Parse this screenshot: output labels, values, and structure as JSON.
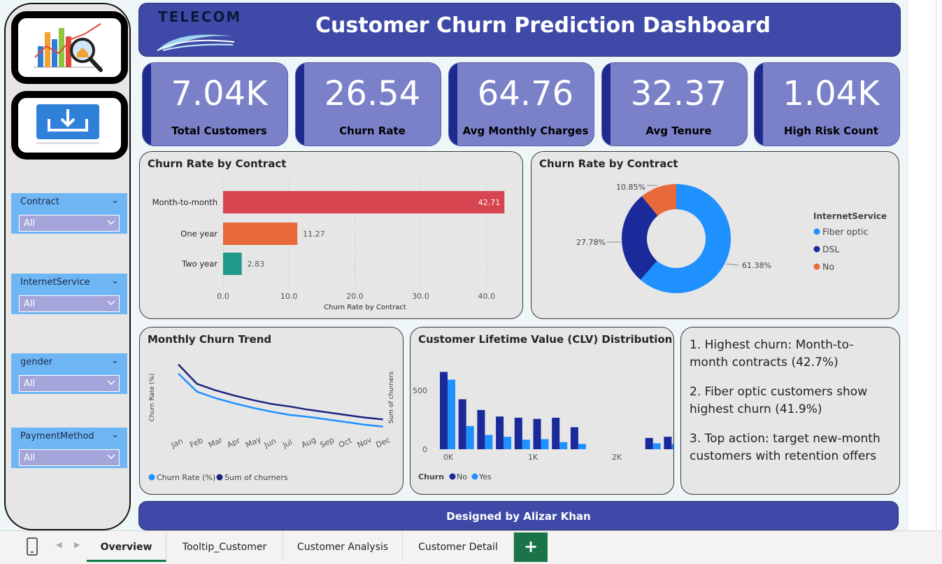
{
  "header": {
    "logo_text": "TELECOM",
    "title": "Customer Churn Prediction Dashboard"
  },
  "slicers": [
    {
      "label": "Contract",
      "value": "All"
    },
    {
      "label": "InternetService",
      "value": "All"
    },
    {
      "label": "gender",
      "value": "All"
    },
    {
      "label": "PaymentMethod",
      "value": "All"
    }
  ],
  "kpis": [
    {
      "value": "7.04K",
      "label": "Total Customers"
    },
    {
      "value": "26.54",
      "label": "Churn Rate"
    },
    {
      "value": "64.76",
      "label": "Avg Monthly Charges"
    },
    {
      "value": "32.37",
      "label": "Avg Tenure"
    },
    {
      "value": "1.04K",
      "label": "High Risk Count"
    }
  ],
  "chart_data": [
    {
      "type": "bar",
      "orientation": "horizontal",
      "title": "Churn Rate by Contract",
      "categories": [
        "Month-to-month",
        "One year",
        "Two year"
      ],
      "values": [
        42.71,
        11.27,
        2.83
      ],
      "data_labels": [
        "42.71",
        "11.27",
        "2.83"
      ],
      "colors": [
        "#d64550",
        "#e8693a",
        "#1f9a8a"
      ],
      "xlabel": "Churn Rate by Contract",
      "xlim": [
        0,
        43
      ],
      "xticks": [
        "0.0",
        "10.0",
        "20.0",
        "30.0",
        "40.0"
      ]
    },
    {
      "type": "pie",
      "subtype": "donut",
      "title": "Churn Rate by Contract",
      "legend_title": "InternetService",
      "legend_position": "right",
      "slices": [
        {
          "name": "Fiber optic",
          "value": 61.38,
          "label": "61.38%",
          "color": "#1e90ff"
        },
        {
          "name": "DSL",
          "value": 27.78,
          "label": "27.78%",
          "color": "#1a2a9a"
        },
        {
          "name": "No",
          "value": 10.85,
          "label": "10.85%",
          "color": "#e8693a"
        }
      ]
    },
    {
      "type": "line",
      "title": "Monthly Churn Trend",
      "x": [
        "Jan",
        "Feb",
        "Mar",
        "Apr",
        "May",
        "Jun",
        "Jul",
        "Aug",
        "Sep",
        "Oct",
        "Nov",
        "Dec"
      ],
      "ylabel": "Churn Rate (%)",
      "y2label": "Sum of churners",
      "series": [
        {
          "name": "Churn Rate (%)",
          "color": "#1e90ff",
          "values": [
            45,
            31,
            26,
            22,
            18.5,
            15.5,
            13,
            11.5,
            9.5,
            7.5,
            5.5,
            4
          ]
        },
        {
          "name": "Sum of churners",
          "color": "#1a2380",
          "values": [
            52,
            37,
            32,
            28,
            24.5,
            21.5,
            19.5,
            17,
            15,
            13,
            11,
            9.5
          ]
        }
      ]
    },
    {
      "type": "bar",
      "title": "Customer Lifetime Value (CLV) Distribution",
      "legend_title": "Churn",
      "x_ticks": [
        "0K",
        "1K",
        "2K"
      ],
      "y_ticks": [
        "0",
        "500"
      ],
      "ylim": [
        0,
        700
      ],
      "series": [
        {
          "name": "No",
          "color": "#1a2a9a",
          "values": [
            650,
            420,
            330,
            275,
            265,
            255,
            265,
            185,
            0,
            0,
            0,
            95,
            105
          ]
        },
        {
          "name": "Yes",
          "color": "#1e90ff",
          "values": [
            585,
            195,
            120,
            105,
            80,
            85,
            60,
            45,
            0,
            0,
            0,
            50,
            45
          ]
        }
      ]
    }
  ],
  "insights": [
    "1. Highest churn: Month-to-month contracts (42.7%)",
    "2. Fiber optic customers show highest churn (41.9%)",
    "3. Top action: target new-month customers with retention offers"
  ],
  "footer": {
    "text": "Designed by Alizar Khan"
  },
  "tabs": [
    {
      "label": "Overview",
      "active": true
    },
    {
      "label": "Tooltip_Customer",
      "active": false
    },
    {
      "label": "Customer Analysis",
      "active": false
    },
    {
      "label": "Customer Detail",
      "active": false
    }
  ],
  "add_tab_label": "+",
  "icons": [
    "chart-magnifier-icon",
    "download-icon",
    "chevron-down-icon",
    "phone-layout-icon",
    "nav-prev-icon",
    "nav-next-icon"
  ]
}
